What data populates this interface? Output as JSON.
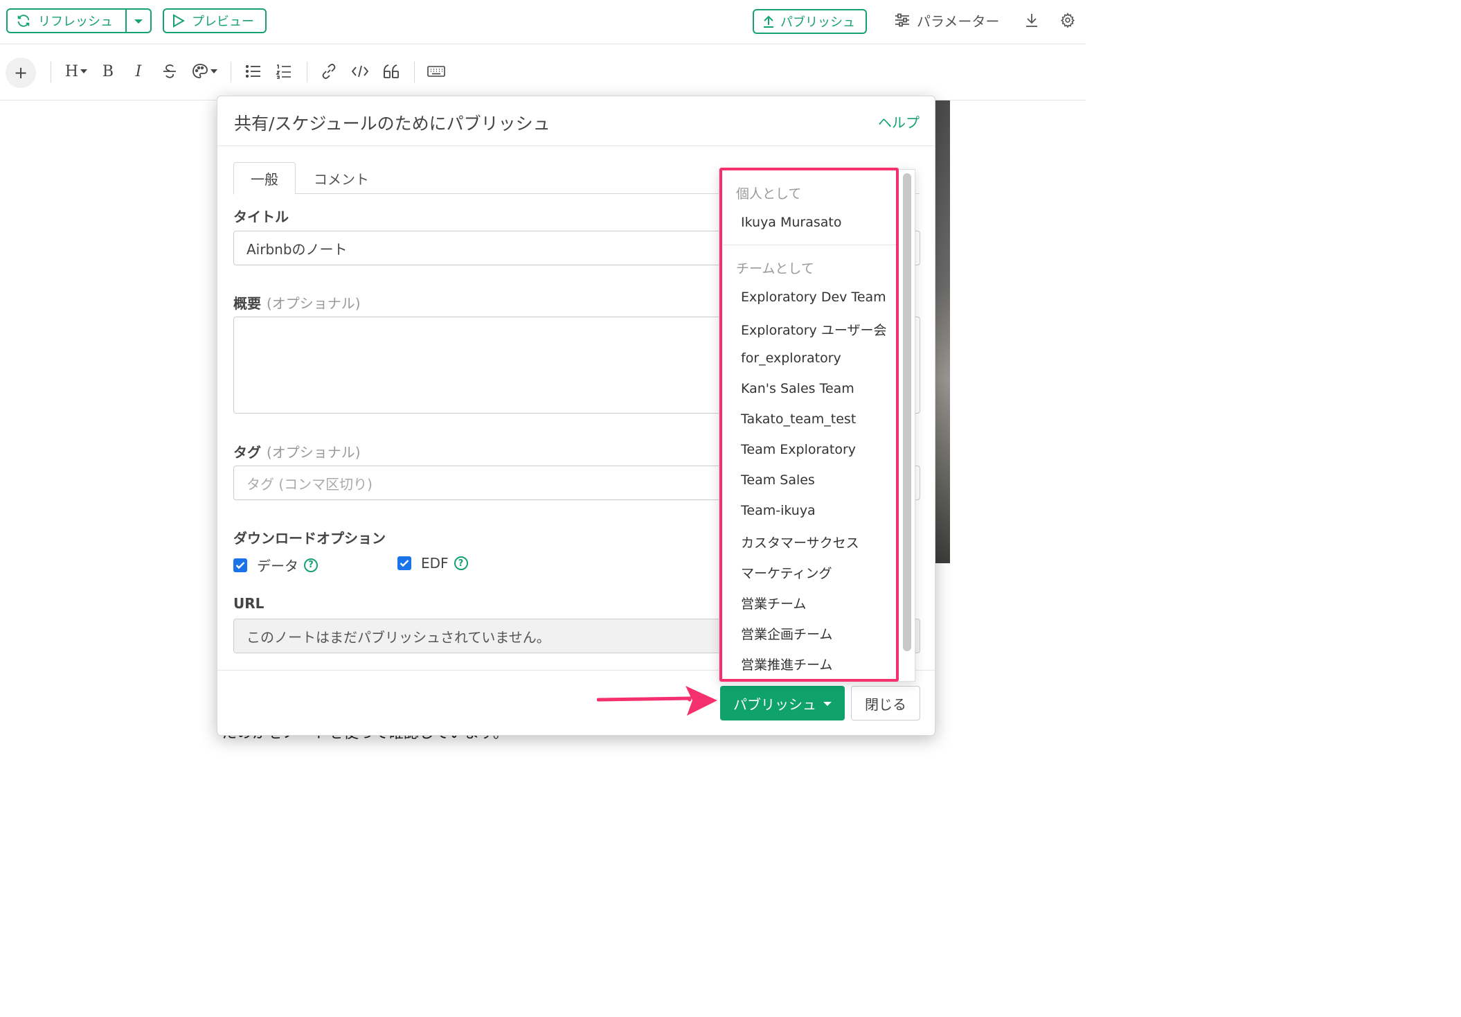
{
  "topbar": {
    "refresh_label": "リフレッシュ",
    "preview_label": "プレビュー",
    "publish_label": "パブリッシュ",
    "parameters_label": "パラメーター"
  },
  "toolbar": {
    "heading_label": "H",
    "bold_label": "B",
    "italic_label": "I",
    "plus_label": "+"
  },
  "background": {
    "text": "たのかをノートを使って確認しています。"
  },
  "modal": {
    "title": "共有/スケジュールのためにパブリッシュ",
    "help": "ヘルプ",
    "tabs": [
      {
        "label": "一般",
        "active": true
      },
      {
        "label": "コメント",
        "active": false
      }
    ],
    "title_field": {
      "label": "タイトル",
      "value": "Airbnbのノート"
    },
    "summary_field": {
      "label": "概要",
      "optional": "(オプショナル)",
      "value": ""
    },
    "tag_field": {
      "label": "タグ",
      "optional": "(オプショナル)",
      "placeholder": "タグ (コンマ区切り)"
    },
    "download": {
      "label": "ダウンロードオプション",
      "options": [
        {
          "label": "データ",
          "checked": true,
          "help": "?"
        },
        {
          "label": "EDF",
          "checked": true,
          "help": "?"
        }
      ]
    },
    "url": {
      "label": "URL",
      "value": "このノートはまだパブリッシュされていません。"
    },
    "publish_button": "パブリッシュ",
    "close_button": "閉じる"
  },
  "dropdown": {
    "personal_header": "個人として",
    "personal_items": [
      "Ikuya Murasato"
    ],
    "team_header": "チームとして",
    "team_items": [
      "Exploratory Dev Team",
      "Exploratory ユーザー会",
      "for_exploratory",
      "Kan's Sales Team",
      "Takato_team_test",
      "Team Exploratory",
      "Team Sales",
      "Team-ikuya",
      "カスタマーサクセス",
      "マーケティング",
      "営業チーム",
      "営業企画チーム",
      "営業推進チーム"
    ]
  },
  "colors": {
    "accent": "#16a26f",
    "primary_button": "#0fa36b",
    "highlight": "#f5306f",
    "checkbox": "#1a73e8"
  }
}
